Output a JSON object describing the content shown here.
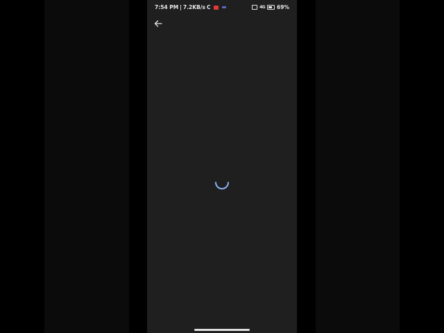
{
  "status_bar": {
    "time": "7:54 PM",
    "separator": "|",
    "network_speed": "7.2KB/s",
    "sync_glyph": "C",
    "signal_label": "4G",
    "battery_percent": "69%",
    "icons": [
      "notification-red-icon",
      "notification-blue-icon",
      "vpn-icon",
      "signal-icon",
      "battery-icon"
    ]
  },
  "toolbar": {
    "back_icon": "arrow-left-icon"
  },
  "content": {
    "state": "loading",
    "spinner_color": "#8ab4f8"
  },
  "colors": {
    "screen_background": "#1f1f1f",
    "outer_background": "#000000",
    "text": "#e8e8e8"
  }
}
